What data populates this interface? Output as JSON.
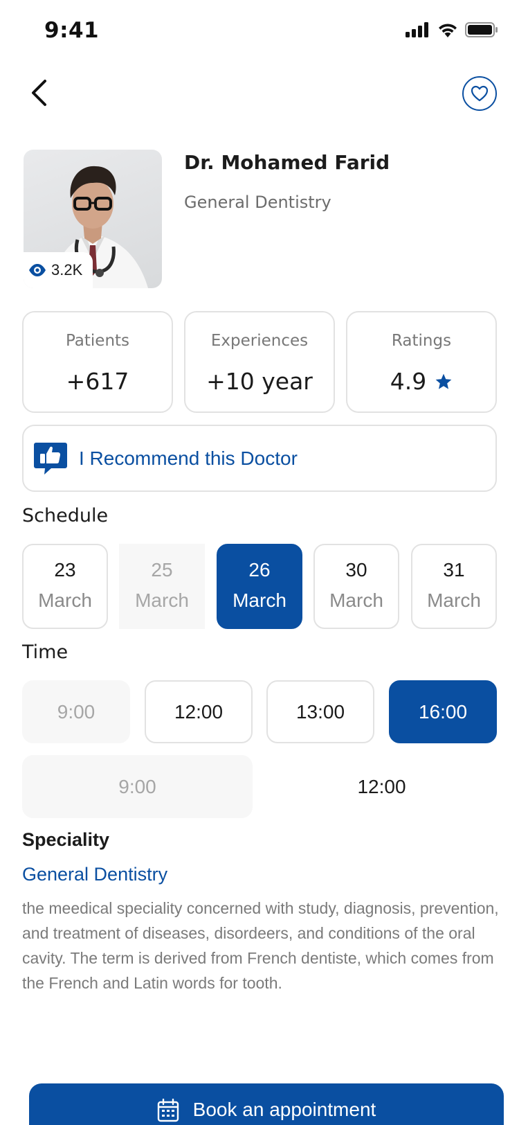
{
  "status_bar": {
    "time": "9:41"
  },
  "doctor": {
    "name": "Dr. Mohamed Farid",
    "specialty": "General Dentistry",
    "views": "3.2K"
  },
  "stats": [
    {
      "label": "Patients",
      "value": "+617"
    },
    {
      "label": "Experiences",
      "value": "+10 year"
    },
    {
      "label": "Ratings",
      "value": "4.9"
    }
  ],
  "recommend": {
    "label": "I Recommend this Doctor"
  },
  "schedule": {
    "title": "Schedule",
    "dates": [
      {
        "day": "23",
        "month": "March",
        "state": "available"
      },
      {
        "day": "25",
        "month": "March",
        "state": "disabled"
      },
      {
        "day": "26",
        "month": "March",
        "state": "selected"
      },
      {
        "day": "30",
        "month": "March",
        "state": "available"
      },
      {
        "day": "31",
        "month": "March",
        "state": "available"
      }
    ]
  },
  "time": {
    "title": "Time",
    "slots": [
      {
        "label": "9:00",
        "state": "disabled"
      },
      {
        "label": "12:00",
        "state": "available"
      },
      {
        "label": "13:00",
        "state": "available"
      },
      {
        "label": "16:00",
        "state": "selected"
      },
      {
        "label": "9:00",
        "state": "disabled"
      },
      {
        "label": "12:00",
        "state": "available"
      }
    ]
  },
  "speciality": {
    "heading": "Speciality",
    "name": "General Dentistry",
    "description": "the meedical speciality concerned with study, diagnosis, prevention, and treatment of diseases, disordeers, and conditions of the oral cavity. The term is derived from French dentiste, which comes from the French and Latin words for tooth."
  },
  "book_button": {
    "label": "Book an appointment"
  },
  "colors": {
    "accent": "#0a4fa1",
    "border": "#e2e2e2",
    "muted_text": "#7a7a7a",
    "star": "#0a4fa1"
  },
  "icons": [
    "back-arrow-icon",
    "heart-icon",
    "eye-icon",
    "star-icon",
    "thumbs-up-icon",
    "calendar-icon",
    "signal-icon",
    "wifi-icon",
    "battery-icon"
  ]
}
